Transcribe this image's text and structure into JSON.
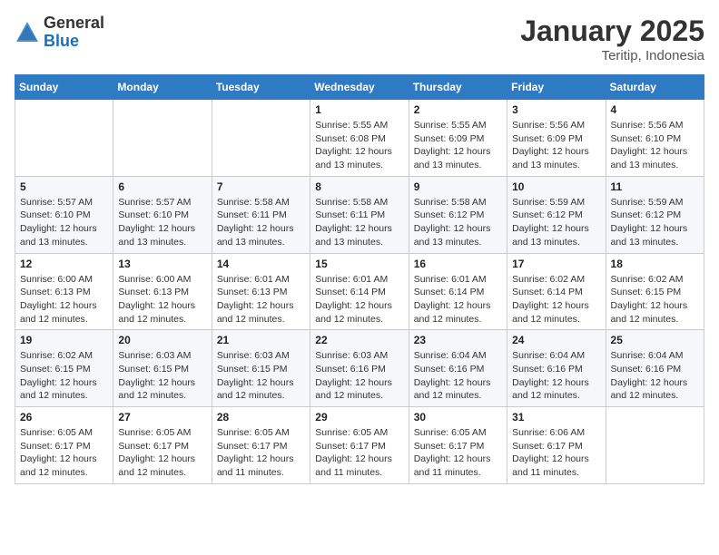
{
  "logo": {
    "general": "General",
    "blue": "Blue"
  },
  "header": {
    "month": "January 2025",
    "location": "Teritip, Indonesia"
  },
  "weekdays": [
    "Sunday",
    "Monday",
    "Tuesday",
    "Wednesday",
    "Thursday",
    "Friday",
    "Saturday"
  ],
  "weeks": [
    [
      {
        "day": "",
        "info": ""
      },
      {
        "day": "",
        "info": ""
      },
      {
        "day": "",
        "info": ""
      },
      {
        "day": "1",
        "info": "Sunrise: 5:55 AM\nSunset: 6:08 PM\nDaylight: 12 hours\nand 13 minutes."
      },
      {
        "day": "2",
        "info": "Sunrise: 5:55 AM\nSunset: 6:09 PM\nDaylight: 12 hours\nand 13 minutes."
      },
      {
        "day": "3",
        "info": "Sunrise: 5:56 AM\nSunset: 6:09 PM\nDaylight: 12 hours\nand 13 minutes."
      },
      {
        "day": "4",
        "info": "Sunrise: 5:56 AM\nSunset: 6:10 PM\nDaylight: 12 hours\nand 13 minutes."
      }
    ],
    [
      {
        "day": "5",
        "info": "Sunrise: 5:57 AM\nSunset: 6:10 PM\nDaylight: 12 hours\nand 13 minutes."
      },
      {
        "day": "6",
        "info": "Sunrise: 5:57 AM\nSunset: 6:10 PM\nDaylight: 12 hours\nand 13 minutes."
      },
      {
        "day": "7",
        "info": "Sunrise: 5:58 AM\nSunset: 6:11 PM\nDaylight: 12 hours\nand 13 minutes."
      },
      {
        "day": "8",
        "info": "Sunrise: 5:58 AM\nSunset: 6:11 PM\nDaylight: 12 hours\nand 13 minutes."
      },
      {
        "day": "9",
        "info": "Sunrise: 5:58 AM\nSunset: 6:12 PM\nDaylight: 12 hours\nand 13 minutes."
      },
      {
        "day": "10",
        "info": "Sunrise: 5:59 AM\nSunset: 6:12 PM\nDaylight: 12 hours\nand 13 minutes."
      },
      {
        "day": "11",
        "info": "Sunrise: 5:59 AM\nSunset: 6:12 PM\nDaylight: 12 hours\nand 13 minutes."
      }
    ],
    [
      {
        "day": "12",
        "info": "Sunrise: 6:00 AM\nSunset: 6:13 PM\nDaylight: 12 hours\nand 12 minutes."
      },
      {
        "day": "13",
        "info": "Sunrise: 6:00 AM\nSunset: 6:13 PM\nDaylight: 12 hours\nand 12 minutes."
      },
      {
        "day": "14",
        "info": "Sunrise: 6:01 AM\nSunset: 6:13 PM\nDaylight: 12 hours\nand 12 minutes."
      },
      {
        "day": "15",
        "info": "Sunrise: 6:01 AM\nSunset: 6:14 PM\nDaylight: 12 hours\nand 12 minutes."
      },
      {
        "day": "16",
        "info": "Sunrise: 6:01 AM\nSunset: 6:14 PM\nDaylight: 12 hours\nand 12 minutes."
      },
      {
        "day": "17",
        "info": "Sunrise: 6:02 AM\nSunset: 6:14 PM\nDaylight: 12 hours\nand 12 minutes."
      },
      {
        "day": "18",
        "info": "Sunrise: 6:02 AM\nSunset: 6:15 PM\nDaylight: 12 hours\nand 12 minutes."
      }
    ],
    [
      {
        "day": "19",
        "info": "Sunrise: 6:02 AM\nSunset: 6:15 PM\nDaylight: 12 hours\nand 12 minutes."
      },
      {
        "day": "20",
        "info": "Sunrise: 6:03 AM\nSunset: 6:15 PM\nDaylight: 12 hours\nand 12 minutes."
      },
      {
        "day": "21",
        "info": "Sunrise: 6:03 AM\nSunset: 6:15 PM\nDaylight: 12 hours\nand 12 minutes."
      },
      {
        "day": "22",
        "info": "Sunrise: 6:03 AM\nSunset: 6:16 PM\nDaylight: 12 hours\nand 12 minutes."
      },
      {
        "day": "23",
        "info": "Sunrise: 6:04 AM\nSunset: 6:16 PM\nDaylight: 12 hours\nand 12 minutes."
      },
      {
        "day": "24",
        "info": "Sunrise: 6:04 AM\nSunset: 6:16 PM\nDaylight: 12 hours\nand 12 minutes."
      },
      {
        "day": "25",
        "info": "Sunrise: 6:04 AM\nSunset: 6:16 PM\nDaylight: 12 hours\nand 12 minutes."
      }
    ],
    [
      {
        "day": "26",
        "info": "Sunrise: 6:05 AM\nSunset: 6:17 PM\nDaylight: 12 hours\nand 12 minutes."
      },
      {
        "day": "27",
        "info": "Sunrise: 6:05 AM\nSunset: 6:17 PM\nDaylight: 12 hours\nand 12 minutes."
      },
      {
        "day": "28",
        "info": "Sunrise: 6:05 AM\nSunset: 6:17 PM\nDaylight: 12 hours\nand 11 minutes."
      },
      {
        "day": "29",
        "info": "Sunrise: 6:05 AM\nSunset: 6:17 PM\nDaylight: 12 hours\nand 11 minutes."
      },
      {
        "day": "30",
        "info": "Sunrise: 6:05 AM\nSunset: 6:17 PM\nDaylight: 12 hours\nand 11 minutes."
      },
      {
        "day": "31",
        "info": "Sunrise: 6:06 AM\nSunset: 6:17 PM\nDaylight: 12 hours\nand 11 minutes."
      },
      {
        "day": "",
        "info": ""
      }
    ]
  ]
}
